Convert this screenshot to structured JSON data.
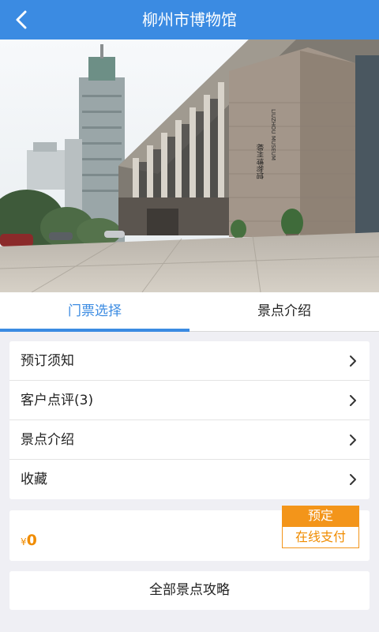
{
  "header": {
    "title": "柳州市博物馆"
  },
  "hero": {
    "sign_lines": [
      "LIUZHOU MUSEUM",
      "柳州博物馆"
    ]
  },
  "tabs": [
    {
      "label": "门票选择",
      "active": true
    },
    {
      "label": "景点介绍",
      "active": false
    }
  ],
  "menu": {
    "items": [
      {
        "label": "预订须知"
      },
      {
        "label": "客户点评(3)"
      },
      {
        "label": "景点介绍"
      },
      {
        "label": "收藏"
      }
    ]
  },
  "ticket": {
    "currency": "¥",
    "price": "0",
    "book_label": "预定",
    "pay_label": "在线支付"
  },
  "guide": {
    "label": "全部景点攻略"
  },
  "colors": {
    "primary": "#3b8be2",
    "accent": "#f3951a",
    "background": "#efeff4"
  }
}
